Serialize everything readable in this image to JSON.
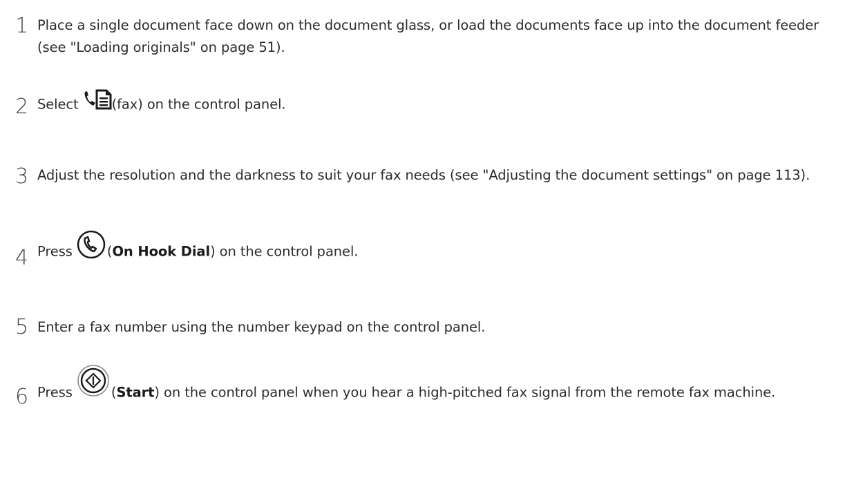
{
  "steps": [
    {
      "number": "1",
      "text": "Place a single document face down on the document glass, or load the documents face up into the document feeder (see \"Loading originals\" on page 51)."
    },
    {
      "number": "2",
      "before": "Select ",
      "after": "(fax) on the control panel.",
      "icon": "phone-document-icon"
    },
    {
      "number": "3",
      "text": "Adjust the resolution and the darkness to suit your fax needs (see \"Adjusting the document settings\" on page 113)."
    },
    {
      "number": "4",
      "before": "Press ",
      "paren_open": "(",
      "bold": "On Hook Dial",
      "after": ") on the control panel.",
      "icon": "on-hook-dial-icon"
    },
    {
      "number": "5",
      "text": "Enter a fax number using the number keypad on the control panel."
    },
    {
      "number": "6",
      "before": "Press ",
      "paren_open": "(",
      "bold": "Start",
      "after": ") on the control panel when you hear a high-pitched fax signal from the remote fax machine.",
      "icon": "start-button-icon"
    }
  ]
}
